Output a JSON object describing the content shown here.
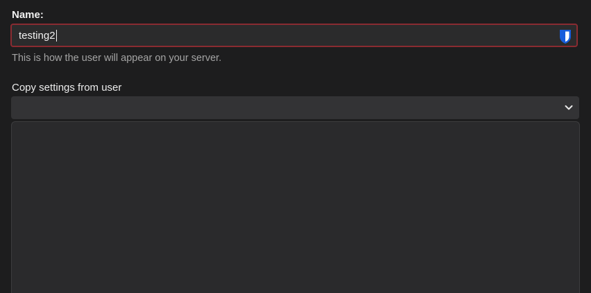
{
  "form": {
    "name_label": "Name:",
    "name_value": "testing2",
    "name_help": "This is how the user will appear on your server.",
    "copy_label": "Copy settings from user",
    "copy_selected": ""
  },
  "colors": {
    "background": "#1d1d1e",
    "input_border_error": "#8a2b31",
    "bitwarden_blue": "#175ddc"
  },
  "icons": {
    "password_manager": "bitwarden-shield-icon",
    "dropdown": "chevron-down-icon"
  }
}
